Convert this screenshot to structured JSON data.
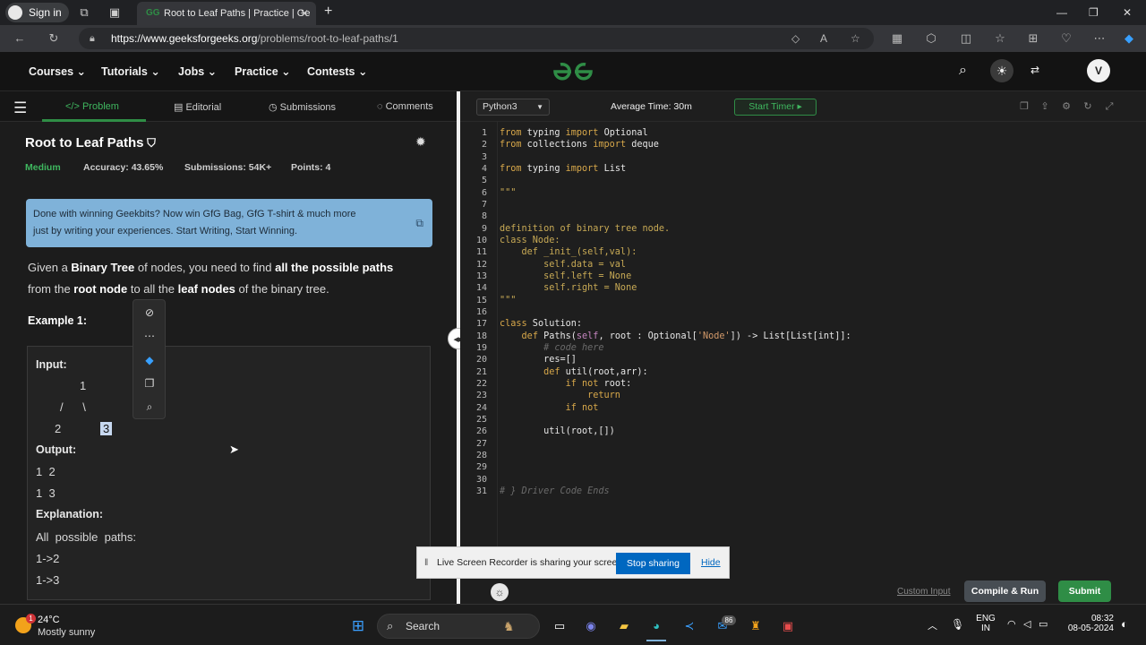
{
  "browser": {
    "sign_in": "Sign in",
    "tab_title": "Root to Leaf Paths | Practice | Ge",
    "url_host": "https://www.geeksforgeeks.org",
    "url_path": "/problems/root-to-leaf-paths/1"
  },
  "nav": {
    "items": [
      "Courses",
      "Tutorials",
      "Jobs",
      "Practice",
      "Contests"
    ],
    "avatar_letter": "V"
  },
  "subtabs": [
    "Problem",
    "Editorial",
    "Submissions",
    "Comments"
  ],
  "problem": {
    "title": "Root to Leaf Paths",
    "difficulty": "Medium",
    "accuracy": "Accuracy: 43.65%",
    "submissions": "Submissions: 54K+",
    "points": "Points: 4",
    "banner_line1": "Done with winning Geekbits? Now win GfG Bag, GfG T-shirt & much more",
    "banner_line2": "just by writing your experiences. Start Writing, Start Winning.",
    "desc_p1": "Given a ",
    "desc_b1": "Binary Tree",
    "desc_p2": " of nodes, you need to find ",
    "desc_b2": "all the possible paths",
    "desc_p3": "from the ",
    "desc_b3": "root node",
    "desc_p4": " to all the ",
    "desc_b4": "leaf nodes",
    "desc_p5": " of the binary tree.",
    "example_title": "Example 1:",
    "input_label": "Input:",
    "tree_root": "1",
    "tree_edges": "/      \\",
    "tree_left": "2",
    "tree_right": "3",
    "output_label": "Output:",
    "output_lines": [
      "1  2",
      "1  3"
    ],
    "explanation_label": "Explanation:",
    "explanation_lines": [
      "All  possible  paths:",
      "1->2",
      "1->3"
    ]
  },
  "editor": {
    "language": "Python3",
    "avg_time": "Average Time: 30m",
    "start_timer": "Start Timer",
    "code_lines": [
      "from typing import Optional",
      "from collections import deque",
      "",
      "from typing import List",
      "",
      "\"\"\"",
      "",
      "",
      "definition of binary tree node.",
      "class Node:",
      "    def _init_(self,val):",
      "        self.data = val",
      "        self.left = None",
      "        self.right = None",
      "\"\"\"",
      "",
      "class Solution:",
      "    def Paths(self, root : Optional['Node']) -> List[List[int]]:",
      "        # code here",
      "        res=[]",
      "        def util(root,arr):",
      "            if not root:",
      "                return",
      "            if not",
      "",
      "        util(root,[])",
      "",
      "",
      "",
      "",
      "# } Driver Code Ends"
    ],
    "custom_input": "Custom Input",
    "compile_run": "Compile & Run",
    "submit": "Submit"
  },
  "share": {
    "message": "Live Screen Recorder is sharing your screen.",
    "stop": "Stop sharing",
    "hide": "Hide"
  },
  "taskbar": {
    "weather_temp": "24°C",
    "weather_desc": "Mostly sunny",
    "search": "Search",
    "lang_line1": "ENG",
    "lang_line2": "IN",
    "time": "08:32",
    "date": "08-05-2024",
    "notification_badge": "1",
    "teams_badge": "86"
  },
  "colors": {
    "gfg_green": "#2f8d46",
    "banner_blue": "#7fb2d9",
    "selection": "#c7d8f0",
    "stop_sharing": "#0067c0"
  }
}
